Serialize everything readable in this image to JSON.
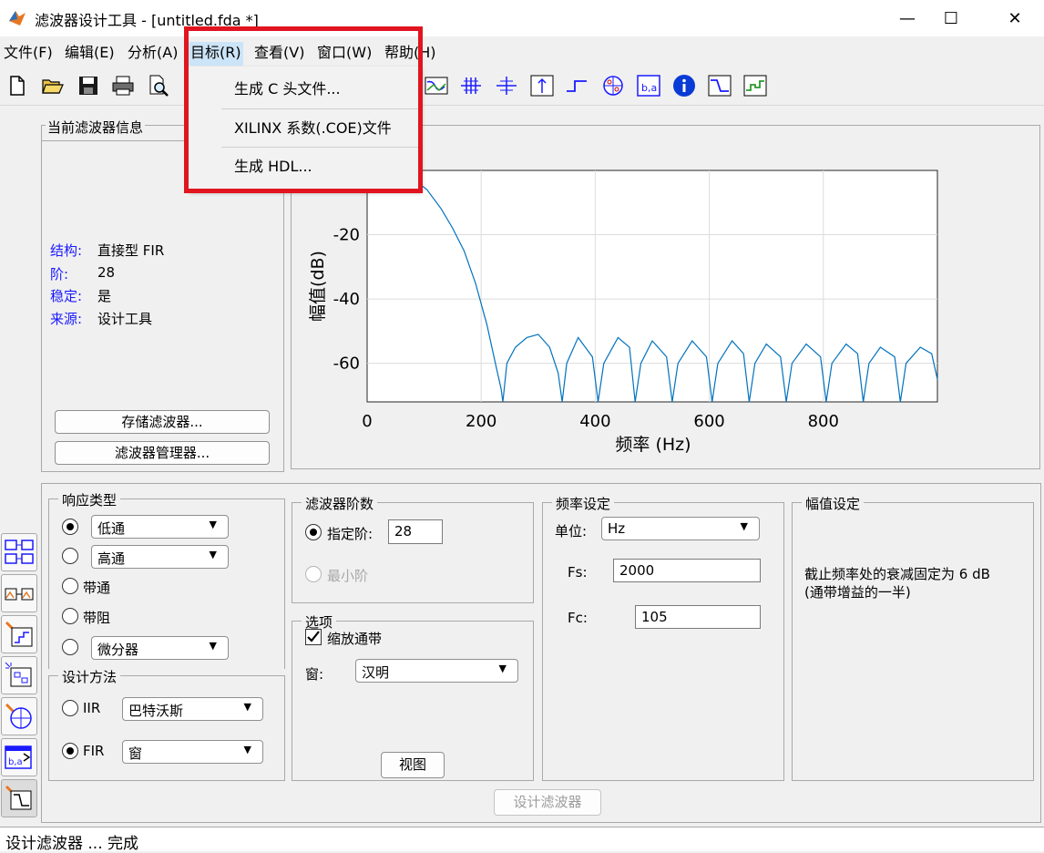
{
  "window": {
    "title": "滤波器设计工具 -  [untitled.fda *]",
    "minimize": "—",
    "maximize": "☐",
    "close": "✕"
  },
  "menubar": {
    "items": [
      {
        "label": "文件(F)"
      },
      {
        "label": "编辑(E)"
      },
      {
        "label": "分析(A)"
      },
      {
        "label": "目标(R)"
      },
      {
        "label": "查看(V)"
      },
      {
        "label": "窗口(W)"
      },
      {
        "label": "帮助(H)"
      }
    ]
  },
  "dropdown": {
    "items": [
      {
        "label": "生成 C 头文件..."
      },
      {
        "label": "XILINX 系数(.COE)文件"
      },
      {
        "label": "生成 HDL..."
      }
    ]
  },
  "info_panel": {
    "title": "当前滤波器信息",
    "rows": [
      {
        "key": "结构:",
        "value": "直接型 FIR"
      },
      {
        "key": "阶:",
        "value": "28"
      },
      {
        "key": "稳定:",
        "value": "是"
      },
      {
        "key": "来源:",
        "value": "设计工具"
      }
    ],
    "store_button": "存储滤波器...",
    "manager_button": "滤波器管理器..."
  },
  "plot": {
    "xlabel": "频率 (Hz)",
    "ylabel": "幅值(dB)",
    "xticks": [
      "0",
      "200",
      "400",
      "600",
      "800"
    ],
    "yticks": [
      "-20",
      "-40",
      "-60"
    ]
  },
  "chart_data": {
    "type": "line",
    "xlabel": "频率 (Hz)",
    "ylabel": "幅值(dB)",
    "xlim": [
      0,
      1000
    ],
    "ylim": [
      -72,
      0
    ],
    "grid": true,
    "series": [
      {
        "x": [
          0,
          50,
          80,
          105,
          130,
          150,
          170,
          190,
          210,
          225,
          235,
          238,
          245,
          260,
          280,
          300,
          320,
          335,
          342,
          350,
          370,
          395,
          405,
          415,
          440,
          460,
          470,
          480,
          500,
          525,
          535,
          545,
          570,
          595,
          605,
          615,
          640,
          660,
          670,
          680,
          700,
          725,
          735,
          745,
          770,
          795,
          805,
          815,
          840,
          860,
          870,
          880,
          900,
          925,
          935,
          945,
          970,
          990,
          1000
        ],
        "y": [
          0,
          -1,
          -2.5,
          -6,
          -12,
          -18,
          -25,
          -35,
          -48,
          -60,
          -68,
          -72,
          -60,
          -55,
          -52,
          -51,
          -55,
          -63,
          -72,
          -60,
          -52,
          -58,
          -72,
          -60,
          -52,
          -55,
          -72,
          -60,
          -53,
          -58,
          -72,
          -60,
          -53,
          -58,
          -72,
          -60,
          -53,
          -57,
          -72,
          -60,
          -54,
          -58,
          -72,
          -60,
          -54,
          -58,
          -72,
          -60,
          -54,
          -57,
          -72,
          -60,
          -55,
          -58,
          -72,
          -60,
          -55,
          -57,
          -65
        ]
      }
    ]
  },
  "response_type": {
    "title": "响应类型",
    "lowpass": "低通",
    "highpass": "高通",
    "bandpass": "带通",
    "bandstop": "带阻",
    "differentiator": "微分器"
  },
  "design_method": {
    "title": "设计方法",
    "iir_label": "IIR",
    "iir_value": "巴特沃斯",
    "fir_label": "FIR",
    "fir_value": "窗"
  },
  "filter_order": {
    "title": "滤波器阶数",
    "specify_label": "指定阶:",
    "specify_value": "28",
    "minimum_label": "最小阶"
  },
  "options": {
    "title": "选项",
    "scale_passband": "缩放通带",
    "window_label": "窗:",
    "window_value": "汉明",
    "view_button": "视图"
  },
  "freq_spec": {
    "title": "频率设定",
    "units_label": "单位:",
    "units_value": "Hz",
    "fs_label": "Fs:",
    "fs_value": "2000",
    "fc_label": "Fc:",
    "fc_value": "105"
  },
  "mag_spec": {
    "title": "幅值设定",
    "text_line1": "截止频率处的衰减固定为 6 dB",
    "text_line2": "(通带增益的一半)"
  },
  "design_button": "设计滤波器",
  "status": "设计滤波器 ... 完成",
  "colors": {
    "accent_red": "#e0151f",
    "menu_hover": "#cce4f7",
    "plot_line": "#0072bd",
    "label_blue": "#1a1aff"
  }
}
